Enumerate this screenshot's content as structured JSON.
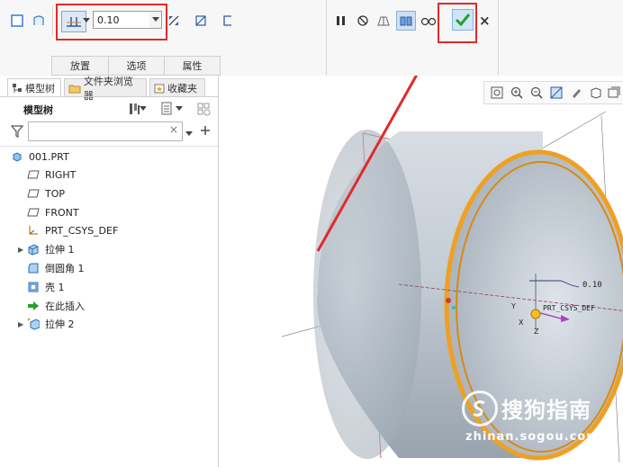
{
  "ribbon": {
    "thickness_value": "0.10",
    "tabs": [
      "放置",
      "选项",
      "属性"
    ],
    "confirm_icon": "check-icon",
    "cancel_label": "×"
  },
  "panel": {
    "tabs": [
      "模型树",
      "文件夹浏览器",
      "收藏夹"
    ],
    "tree_title": "模型树",
    "search_clear": "×",
    "items": [
      {
        "label": "001.PRT",
        "icon": "part-icon"
      },
      {
        "label": "RIGHT",
        "icon": "datum-plane-icon"
      },
      {
        "label": "TOP",
        "icon": "datum-plane-icon"
      },
      {
        "label": "FRONT",
        "icon": "datum-plane-icon"
      },
      {
        "label": "PRT_CSYS_DEF",
        "icon": "csys-icon"
      },
      {
        "label": "拉伸 1",
        "icon": "extrude-icon"
      },
      {
        "label": "倒圆角 1",
        "icon": "round-icon"
      },
      {
        "label": "壳 1",
        "icon": "shell-icon"
      },
      {
        "label": "在此插入",
        "icon": "insert-arrow-icon"
      },
      {
        "label": "拉伸 2",
        "icon": "extrude-new-icon"
      }
    ]
  },
  "viewport": {
    "dimension_label": "0.10",
    "csys_label": "PRT_CSYS_DEF",
    "axis_x": "X",
    "axis_y": "Y",
    "axis_z": "Z",
    "watermark_brand": "搜狗指南",
    "watermark_url": "zhinan.sogou.com"
  },
  "colors": {
    "highlight_red": "#e02a2a",
    "confirm_green": "#2a9d2a",
    "edge_orange": "#f0a020",
    "model_gray": "#bcc4cc"
  }
}
